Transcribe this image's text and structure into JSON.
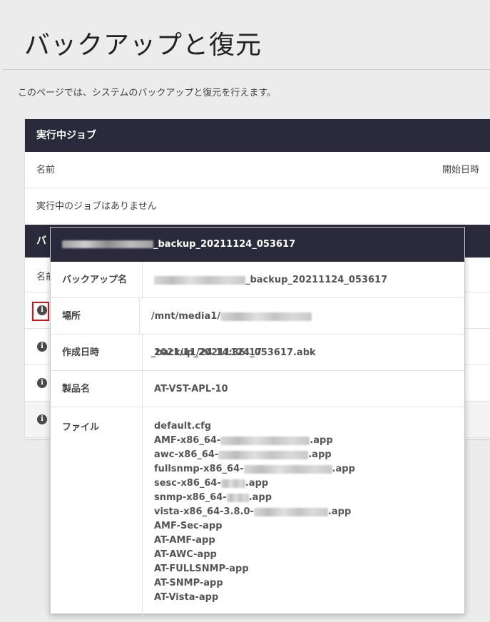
{
  "page": {
    "title": "バックアップと復元",
    "description": "このページでは、システムのバックアップと復元を行えます。"
  },
  "running_jobs": {
    "header": "実行中ジョブ",
    "columns": {
      "name": "名前",
      "start_time": "開始日時"
    },
    "empty_message": "実行中のジョブはありません"
  },
  "backup_list": {
    "header_partial": "バ",
    "name_partial": "名前"
  },
  "popup": {
    "title_suffix": "_backup_20211124_053617",
    "rows": {
      "backup_name": {
        "label": "バックアップ名",
        "value_suffix": "_backup_20211124_053617"
      },
      "location": {
        "label": "場所",
        "value_prefix": "/mnt/media1/",
        "value_suffix": "_backup_20211124_053617.abk"
      },
      "created": {
        "label": "作成日時",
        "value": "2021/11/24 14:36:17"
      },
      "product": {
        "label": "製品名",
        "value": "AT-VST-APL-10"
      },
      "files": {
        "label": "ファイル"
      }
    },
    "files": [
      {
        "prefix": "default.cfg",
        "suffix": ""
      },
      {
        "prefix": "AMF-x86_64-",
        "suffix": ".app"
      },
      {
        "prefix": "awc-x86_64-",
        "suffix": ".app"
      },
      {
        "prefix": "fullsnmp-x86_64-",
        "suffix": ".app"
      },
      {
        "prefix": "sesc-x86_64-",
        "suffix": ".app"
      },
      {
        "prefix": "snmp-x86_64-",
        "suffix": ".app"
      },
      {
        "prefix": "vista-x86_64-3.8.0-",
        "suffix": ".app"
      },
      {
        "prefix": "AMF-Sec-app",
        "suffix": ""
      },
      {
        "prefix": "AT-AMF-app",
        "suffix": ""
      },
      {
        "prefix": "AT-AWC-app",
        "suffix": ""
      },
      {
        "prefix": "AT-FULLSNMP-app",
        "suffix": ""
      },
      {
        "prefix": "AT-SNMP-app",
        "suffix": ""
      },
      {
        "prefix": "AT-Vista-app",
        "suffix": ""
      }
    ]
  },
  "icons": {
    "info": "info-icon",
    "info_glyph": "i"
  },
  "colors": {
    "header_bg": "#2b2a3c",
    "highlight": "#e0101a"
  }
}
